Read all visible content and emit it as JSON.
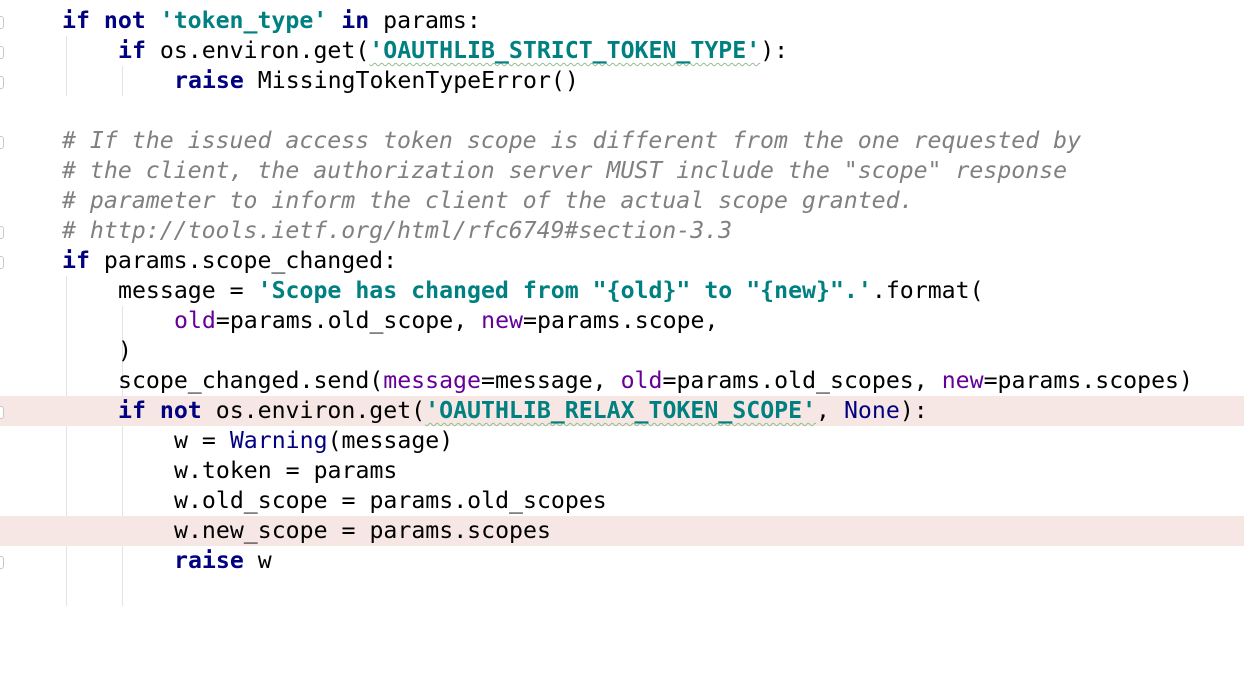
{
  "editor": {
    "language": "python",
    "colors": {
      "keyword": "#000080",
      "string": "#008080",
      "comment": "#808080",
      "named_arg": "#660099",
      "builtin": "#000080",
      "default": "#000000",
      "highlight_line": "#f7e7e4"
    },
    "lines": [
      {
        "indent": 1,
        "highlighted": false,
        "fold": true,
        "tokens": [
          {
            "t": "if",
            "k": "kw"
          },
          {
            "t": " "
          },
          {
            "t": "not",
            "k": "kw"
          },
          {
            "t": " "
          },
          {
            "t": "'token_type'",
            "k": "str"
          },
          {
            "t": " "
          },
          {
            "t": "in",
            "k": "kw"
          },
          {
            "t": " params:"
          }
        ]
      },
      {
        "indent": 2,
        "highlighted": false,
        "fold": true,
        "tokens": [
          {
            "t": "if",
            "k": "kw"
          },
          {
            "t": " os.environ.get("
          },
          {
            "t": "'OAUTHLIB_STRICT_TOKEN_TYPE'",
            "k": "str",
            "squiggle": true
          },
          {
            "t": "):"
          }
        ]
      },
      {
        "indent": 3,
        "highlighted": false,
        "fold": true,
        "tokens": [
          {
            "t": "raise",
            "k": "kw"
          },
          {
            "t": " MissingTokenTypeError()"
          }
        ]
      },
      {
        "indent": 0,
        "highlighted": false,
        "fold": false,
        "tokens": []
      },
      {
        "indent": 1,
        "highlighted": false,
        "fold": true,
        "tokens": [
          {
            "t": "# If the issued access token scope is different from the one requested by",
            "k": "cm"
          }
        ]
      },
      {
        "indent": 1,
        "highlighted": false,
        "fold": false,
        "tokens": [
          {
            "t": "# the client, the authorization server MUST include the \"scope\" response",
            "k": "cm"
          }
        ]
      },
      {
        "indent": 1,
        "highlighted": false,
        "fold": false,
        "tokens": [
          {
            "t": "# parameter to inform the client of the actual scope granted.",
            "k": "cm"
          }
        ]
      },
      {
        "indent": 1,
        "highlighted": false,
        "fold": true,
        "tokens": [
          {
            "t": "# http://tools.ietf.org/html/rfc6749#section-3.3",
            "k": "cm"
          }
        ]
      },
      {
        "indent": 1,
        "highlighted": false,
        "fold": true,
        "tokens": [
          {
            "t": "if",
            "k": "kw"
          },
          {
            "t": " params.scope_changed:"
          }
        ]
      },
      {
        "indent": 2,
        "highlighted": false,
        "fold": false,
        "tokens": [
          {
            "t": "message = "
          },
          {
            "t": "'Scope has changed from \"{old}\" to \"{new}\".'",
            "k": "str"
          },
          {
            "t": ".format("
          }
        ]
      },
      {
        "indent": 3,
        "highlighted": false,
        "fold": false,
        "tokens": [
          {
            "t": "old",
            "k": "named"
          },
          {
            "t": "=params.old_scope, "
          },
          {
            "t": "new",
            "k": "named"
          },
          {
            "t": "=params.scope,"
          }
        ]
      },
      {
        "indent": 2,
        "highlighted": false,
        "fold": false,
        "tokens": [
          {
            "t": ")"
          }
        ]
      },
      {
        "indent": 2,
        "highlighted": false,
        "fold": false,
        "tokens": [
          {
            "t": "scope_changed.send("
          },
          {
            "t": "message",
            "k": "named"
          },
          {
            "t": "=message, "
          },
          {
            "t": "old",
            "k": "named"
          },
          {
            "t": "=params.old_scopes, "
          },
          {
            "t": "new",
            "k": "named"
          },
          {
            "t": "=params.scopes)"
          }
        ]
      },
      {
        "indent": 2,
        "highlighted": true,
        "fold": true,
        "tokens": [
          {
            "t": "if",
            "k": "kw"
          },
          {
            "t": " "
          },
          {
            "t": "not",
            "k": "kw"
          },
          {
            "t": " os.environ.get("
          },
          {
            "t": "'OAUTHLIB_RELAX_TOKEN_SCOPE'",
            "k": "str",
            "squiggle": true
          },
          {
            "t": ", "
          },
          {
            "t": "None",
            "k": "builtin"
          },
          {
            "t": "):"
          }
        ]
      },
      {
        "indent": 3,
        "highlighted": false,
        "fold": false,
        "tokens": [
          {
            "t": "w = "
          },
          {
            "t": "Warning",
            "k": "builtin"
          },
          {
            "t": "(message)"
          }
        ]
      },
      {
        "indent": 3,
        "highlighted": false,
        "fold": false,
        "tokens": [
          {
            "t": "w.token = params"
          }
        ]
      },
      {
        "indent": 3,
        "highlighted": false,
        "fold": false,
        "tokens": [
          {
            "t": "w.old_scope = params.old_scopes"
          }
        ]
      },
      {
        "indent": 3,
        "highlighted": true,
        "fold": false,
        "tokens": [
          {
            "t": "w.new_scope = params.scopes"
          }
        ]
      },
      {
        "indent": 3,
        "highlighted": false,
        "fold": true,
        "tokens": [
          {
            "t": "raise",
            "k": "kw"
          },
          {
            "t": " w"
          }
        ]
      }
    ]
  }
}
